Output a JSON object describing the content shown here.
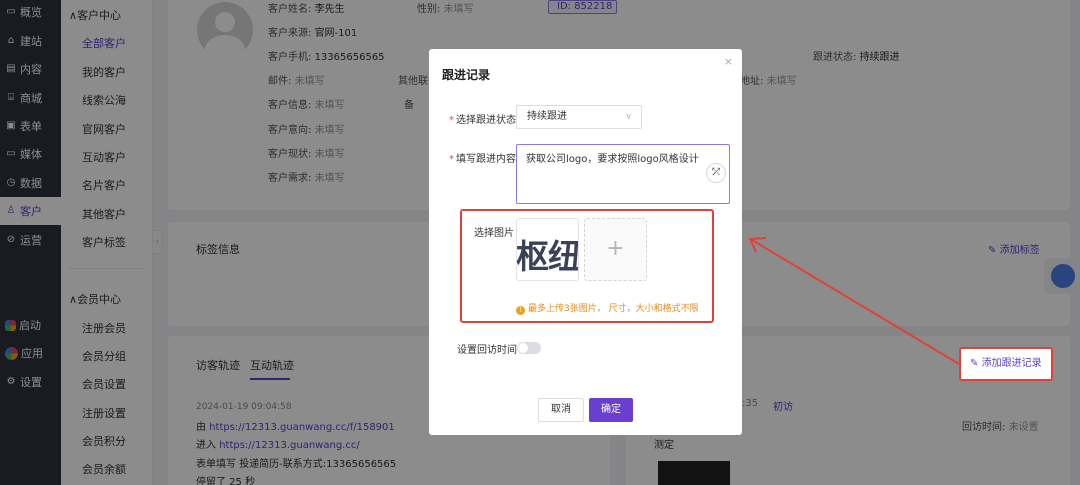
{
  "nav": {
    "items": [
      {
        "label": "概览",
        "icon": "monitor-icon"
      },
      {
        "label": "建站",
        "icon": "home-icon"
      },
      {
        "label": "内容",
        "icon": "document-icon"
      },
      {
        "label": "商城",
        "icon": "store-icon"
      },
      {
        "label": "表单",
        "icon": "form-icon"
      },
      {
        "label": "媒体",
        "icon": "media-icon"
      },
      {
        "label": "数据",
        "icon": "chart-icon"
      },
      {
        "label": "客户",
        "icon": "user-icon"
      },
      {
        "label": "运营",
        "icon": "clip-icon"
      }
    ],
    "bottom": [
      {
        "label": "启动",
        "icon": "launch-icon"
      },
      {
        "label": "应用",
        "icon": "apps-icon"
      },
      {
        "label": "设置",
        "icon": "gear-icon"
      }
    ]
  },
  "subnav": {
    "group1": "客户中心",
    "items1": [
      "全部客户",
      "我的客户",
      "线索公海",
      "官网客户",
      "互动客户",
      "名片客户",
      "其他客户",
      "客户标签"
    ],
    "group2": "会员中心",
    "items2": [
      "注册会员",
      "会员分组",
      "会员设置",
      "注册设置",
      "会员积分",
      "会员余额"
    ]
  },
  "customer": {
    "name_label": "客户姓名:",
    "name": "李先生",
    "gender_label": "性别:",
    "gender": "未填写",
    "id": "ID:  852218",
    "source_label": "客户来源:",
    "source": "官网-101",
    "phone_label": "客户手机:",
    "phone": "13365656565",
    "follow_label": "跟进状态:",
    "follow_status": "持续跟进",
    "email_label": "邮件:",
    "email": "未填写",
    "other_label": "其他联",
    "address_label": "地址:",
    "address": "未填写",
    "info_label": "客户信息:",
    "info": "未填写",
    "note_label": "备",
    "intent_label": "客户意向:",
    "intent": "未填写",
    "status_label": "客户现状:",
    "status": "未填写",
    "need_label": "客户需求:",
    "need": "未填写"
  },
  "tags": {
    "title": "标签信息",
    "add": "添加标签"
  },
  "tracks": {
    "tabs": [
      "访客轨迹",
      "互动轨迹"
    ],
    "time": "2024-01-19 09:04:58",
    "from_prefix": "由",
    "from_url": "https://12313.guanwang.cc/f/158901",
    "enter_prefix": "进入",
    "enter_url": "https://12313.guanwang.cc/",
    "form_text": "表单填写 投递简历-联系方式:13365656565",
    "stay_text": "停留了 25 秒",
    "right_time": ":35",
    "right_tag": "初访",
    "revisit_label": "回访时间:",
    "revisit_value": "未设置",
    "right_content": "测定"
  },
  "modal": {
    "title": "跟进记录",
    "close": "×",
    "status_label": "选择跟进状态",
    "status_value": "持续跟进",
    "content_label": "填写跟进内容",
    "content_value": "获取公司logo，要求按照logo风格设计",
    "image_label": "选择图片",
    "thumb_text": "枢纽",
    "add_symbol": "+",
    "tip": "最多上传3张图片， 尺寸，大小和格式不限",
    "revisit_label": "设置回访时间",
    "cancel": "取消",
    "confirm": "确定"
  },
  "annotation": {
    "callout": "添加跟进记录",
    "color": "#e0423a"
  },
  "colors": {
    "accent": "#5b3fd0",
    "sidebar": "#2f3240"
  }
}
